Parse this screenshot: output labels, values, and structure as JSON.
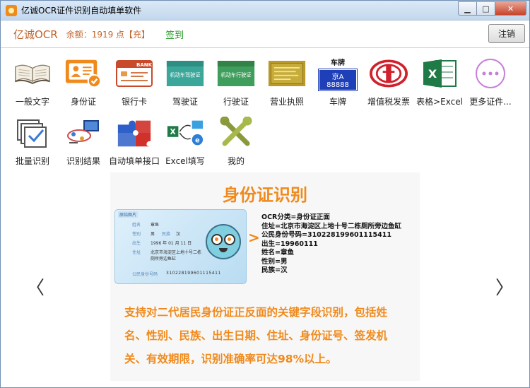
{
  "window": {
    "title": "亿诚OCR证件识别自动填单软件",
    "controls": {
      "minimize": "▁",
      "maximize": "□",
      "close": "✕"
    }
  },
  "header": {
    "brand": "亿诚OCR",
    "balance": "余额：1919 点【充】",
    "checkin": "签到",
    "logout": "注销"
  },
  "tools": [
    {
      "label": "一般文字",
      "icon": "open-book-icon"
    },
    {
      "label": "身份证",
      "icon": "id-card-icon"
    },
    {
      "label": "银行卡",
      "icon": "bank-card-icon"
    },
    {
      "label": "驾驶证",
      "icon": "driver-license-icon",
      "card_text": "机动车驾驶证"
    },
    {
      "label": "行驶证",
      "icon": "vehicle-license-icon",
      "card_text": "机动车行驶证"
    },
    {
      "label": "营业执照",
      "icon": "business-license-icon"
    },
    {
      "label": "车牌",
      "icon": "license-plate-icon",
      "plate_title": "车牌",
      "plate_text": "京A 88888"
    },
    {
      "label": "增值税发票",
      "icon": "vat-invoice-icon"
    },
    {
      "label": "表格>Excel",
      "icon": "excel-icon"
    },
    {
      "label": "更多证件...",
      "icon": "more-icon"
    },
    {
      "label": "批量识别",
      "icon": "batch-icon"
    },
    {
      "label": "识别结果",
      "icon": "result-icon"
    },
    {
      "label": "自动填单接口",
      "icon": "puzzle-icon"
    },
    {
      "label": "Excel填写",
      "icon": "excel-fill-icon"
    },
    {
      "label": "我的",
      "icon": "tools-icon"
    }
  ],
  "slide": {
    "title": "身份证识别",
    "card": {
      "tag": "原始图片",
      "name_label": "姓名",
      "name": "章鱼",
      "gender_label": "性别",
      "gender": "男",
      "nation_label": "民族",
      "nation": "汉",
      "birth_label": "出生",
      "birth": "1996 年 01 月 11 日",
      "address_label": "住址",
      "address1": "北京市海淀区上地十号二栋",
      "address2": "厕所旁边鱼缸",
      "id_label": "公民身份号码",
      "id_number": "310228199601115411"
    },
    "ocr_lines": [
      "OCR分类=身份证正面",
      "住址=北京市海淀区上地十号二栋厕所旁边鱼缸",
      "公民身份号码=310228199601115411",
      "出生=19960111",
      "姓名=章鱼",
      "性别=男",
      "民族=汉"
    ],
    "description": "支持对二代居民身份证正反面的关键字段识别，包括姓名、性别、民族、出生日期、住址、身份证号、签发机关、有效期限，识别准确率可达98%以上。"
  },
  "nav": {
    "prev": "〈",
    "next": "〉"
  },
  "colors": {
    "accent": "#f08a1c",
    "checkin": "#2a9a2a"
  }
}
